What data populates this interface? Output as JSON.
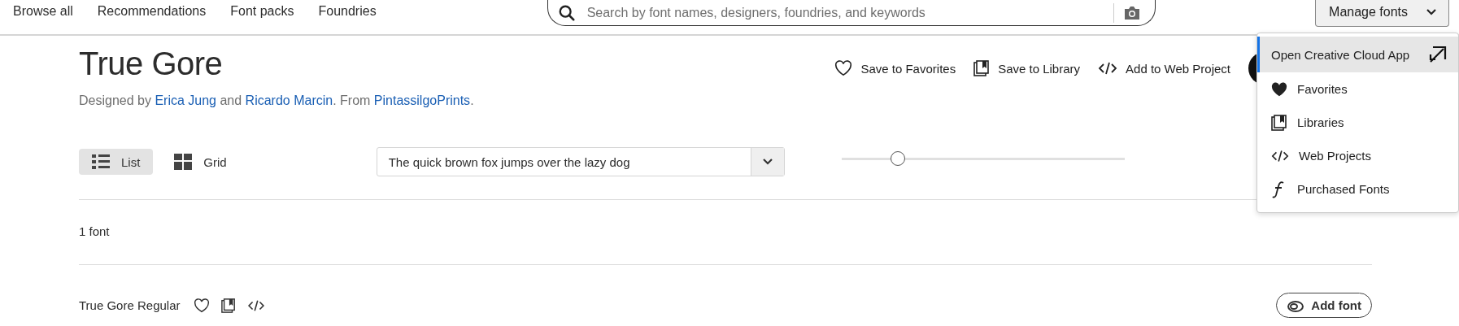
{
  "nav": {
    "links": [
      "Browse all",
      "Recommendations",
      "Font packs",
      "Foundries"
    ],
    "search": {
      "placeholder": "Search by font names, designers, foundries, and keywords"
    },
    "manage_button": "Manage fonts"
  },
  "family": {
    "title": "True Gore",
    "credit": {
      "prefix": "Designed by",
      "designers": [
        "Erica Jung",
        "Ricardo Marcin"
      ],
      "joiner": "and",
      "from": ". From",
      "foundry": "PintassilgoPrints",
      "end": "."
    },
    "actions": [
      "Save to Favorites",
      "Save to Library",
      "Add to Web Project"
    ]
  },
  "menu": {
    "items": [
      {
        "kind": "open",
        "label": "Open Creative Cloud App",
        "selected": true
      },
      {
        "kind": "favorites",
        "label": "Favorites",
        "selected": false
      },
      {
        "kind": "libraries",
        "label": "Libraries",
        "selected": false
      },
      {
        "kind": "web",
        "label": "Web Projects",
        "selected": false
      },
      {
        "kind": "purchased",
        "label": "Purchased Fonts",
        "selected": false
      }
    ]
  },
  "view_toggle": [
    {
      "kind": "list",
      "label": "List",
      "selected": true
    },
    {
      "kind": "grid",
      "label": "Grid",
      "selected": false
    }
  ],
  "sample": {
    "value": "The quick brown fox jumps over the lazy dog"
  },
  "size_slider": {
    "level": 0.2
  },
  "count": "1 font",
  "fonts": [
    {
      "name": "True Gore Regular",
      "add_label": "Add font"
    }
  ]
}
